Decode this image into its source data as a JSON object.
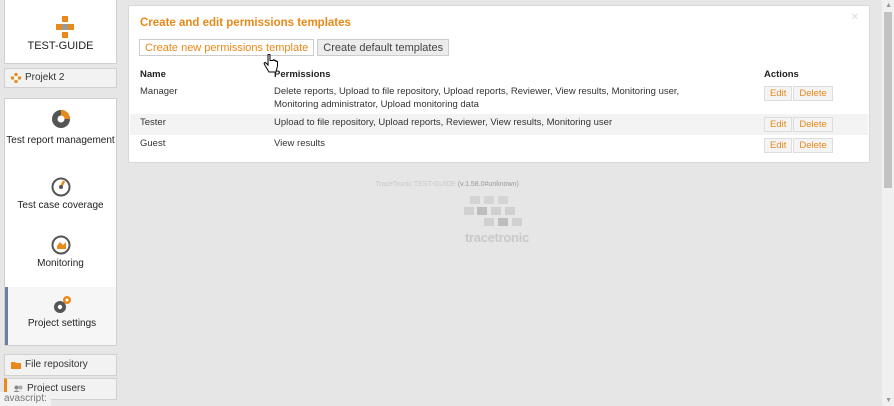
{
  "sidebar": {
    "brand": "TEST-GUIDE",
    "project": "Projekt 2",
    "nav": [
      {
        "label": "Test report management",
        "icon": "pie-chart-icon"
      },
      {
        "label": "Test case coverage",
        "icon": "gauge-icon"
      },
      {
        "label": "Monitoring",
        "icon": "monitoring-icon"
      },
      {
        "label": "Project settings",
        "icon": "gears-icon"
      }
    ],
    "sub": [
      {
        "label": "File repository",
        "icon": "folder-icon"
      },
      {
        "label": "Project users",
        "icon": "users-icon"
      }
    ]
  },
  "status_text": "avascript:",
  "panel": {
    "title": "Create and edit permissions templates",
    "tabs": [
      "Create new permissions template",
      "Create default templates"
    ],
    "columns": {
      "name": "Name",
      "permissions": "Permissions",
      "actions": "Actions"
    },
    "rows": [
      {
        "name": "Manager",
        "permissions": "Delete reports, Upload to file repository, Upload reports, Reviewer, View results, Monitoring user, Monitoring administrator, Upload monitoring data"
      },
      {
        "name": "Tester",
        "permissions": "Upload to file repository, Upload reports, Reviewer, View results, Monitoring user"
      },
      {
        "name": "Guest",
        "permissions": "View results"
      }
    ],
    "edit_label": "Edit",
    "delete_label": "Delete"
  },
  "footer": {
    "company": "TraceTronic TEST-GUIDE",
    "version": "(v.1.58.0#unknown)",
    "logo_word": "tracetronic"
  },
  "colors": {
    "accent": "#e8891a",
    "background": "#e6e6e6",
    "panel": "#ffffff"
  }
}
